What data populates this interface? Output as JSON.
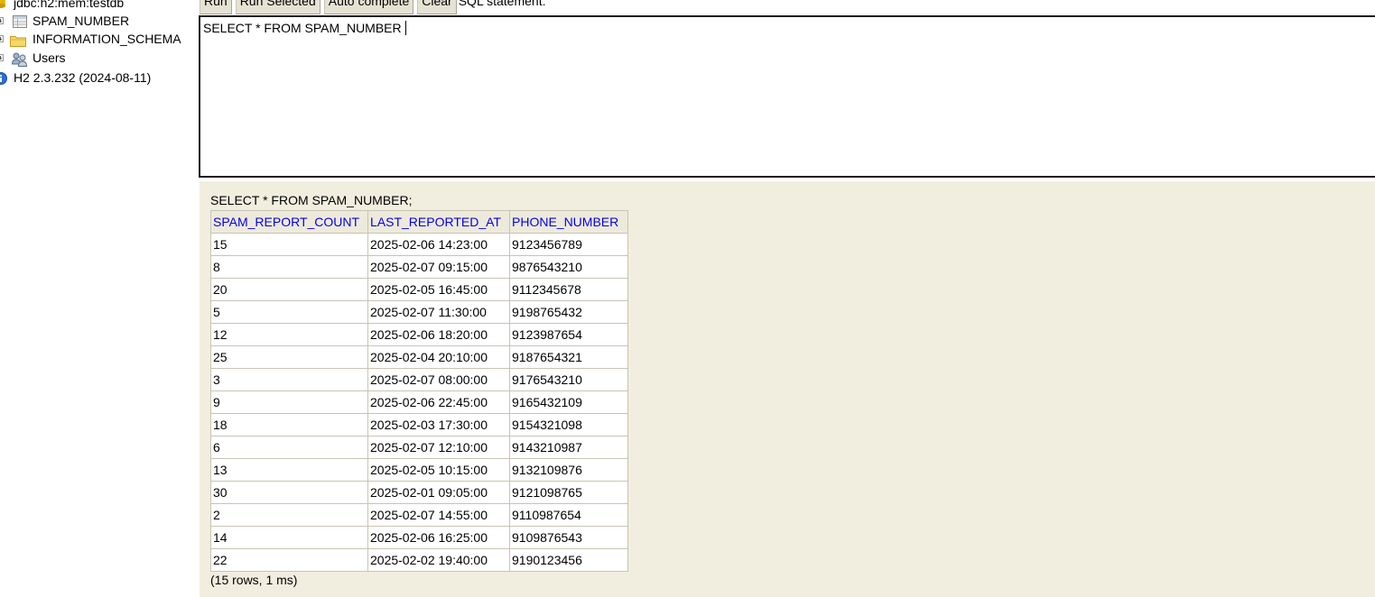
{
  "tree": {
    "connection_label": "jdbc:h2:mem:testdb",
    "items": [
      {
        "label": "SPAM_NUMBER",
        "icon": "table-icon"
      },
      {
        "label": "INFORMATION_SCHEMA",
        "icon": "folder-icon"
      },
      {
        "label": "Users",
        "icon": "users-icon"
      }
    ],
    "version_label": "H2 2.3.232 (2024-08-11)"
  },
  "toolbar": {
    "run_label": "Run",
    "run_selected_label": "Run Selected",
    "auto_complete_label": "Auto complete",
    "clear_label": "Clear",
    "sql_statement_label": "SQL statement:"
  },
  "editor": {
    "sql_text": "SELECT * FROM SPAM_NUMBER"
  },
  "results": {
    "statement": "SELECT * FROM SPAM_NUMBER;",
    "columns": [
      "SPAM_REPORT_COUNT",
      "LAST_REPORTED_AT",
      "PHONE_NUMBER"
    ],
    "rows": [
      [
        "15",
        "2025-02-06 14:23:00",
        "9123456789"
      ],
      [
        "8",
        "2025-02-07 09:15:00",
        "9876543210"
      ],
      [
        "20",
        "2025-02-05 16:45:00",
        "9112345678"
      ],
      [
        "5",
        "2025-02-07 11:30:00",
        "9198765432"
      ],
      [
        "12",
        "2025-02-06 18:20:00",
        "9123987654"
      ],
      [
        "25",
        "2025-02-04 20:10:00",
        "9187654321"
      ],
      [
        "3",
        "2025-02-07 08:00:00",
        "9176543210"
      ],
      [
        "9",
        "2025-02-06 22:45:00",
        "9165432109"
      ],
      [
        "18",
        "2025-02-03 17:30:00",
        "9154321098"
      ],
      [
        "6",
        "2025-02-07 12:10:00",
        "9143210987"
      ],
      [
        "13",
        "2025-02-05 10:15:00",
        "9132109876"
      ],
      [
        "30",
        "2025-02-01 09:05:00",
        "9121098765"
      ],
      [
        "2",
        "2025-02-07 14:55:00",
        "9110987654"
      ],
      [
        "14",
        "2025-02-06 16:25:00",
        "9109876543"
      ],
      [
        "22",
        "2025-02-02 19:40:00",
        "9190123456"
      ]
    ],
    "summary": "(15 rows, 1 ms)"
  },
  "colors": {
    "results_background": "#f2eedf",
    "header_link": "#0000ee",
    "button_background": "#e6e2d3"
  }
}
